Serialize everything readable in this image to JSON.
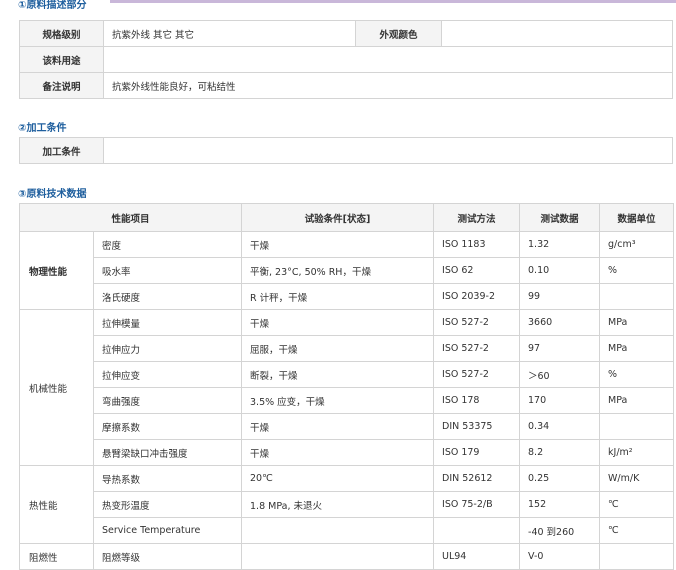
{
  "sections": {
    "s1": "①原料描述部分",
    "s2": "②加工条件",
    "s3": "③原料技术数据"
  },
  "desc": {
    "grade_label": "规格级别",
    "grade_value": "抗紫外线 其它 其它",
    "color_label": "外观颜色",
    "color_value": "",
    "use_label": "该料用途",
    "use_value": "",
    "note_label": "备注说明",
    "note_value": "抗紫外线性能良好，可粘结性"
  },
  "proc": {
    "label": "加工条件",
    "value": ""
  },
  "tech": {
    "headers": [
      "性能项目",
      "试验条件[状态]",
      "测试方法",
      "测试数据",
      "数据单位"
    ],
    "groups": [
      {
        "category": "物理性能",
        "bold": true,
        "rows": [
          [
            "密度",
            "干燥",
            "ISO 1183",
            "1.32",
            "g/cm³"
          ],
          [
            "吸水率",
            "平衡, 23°C, 50% RH，干燥",
            "ISO 62",
            "0.10",
            "%"
          ],
          [
            "洛氏硬度",
            "R 计秤，干燥",
            "ISO 2039-2",
            "99",
            ""
          ]
        ]
      },
      {
        "category": "机械性能",
        "bold": false,
        "rows": [
          [
            "拉伸模量",
            "干燥",
            "ISO 527-2",
            "3660",
            "MPa"
          ],
          [
            "拉伸应力",
            "屈服，干燥",
            "ISO 527-2",
            "97",
            "MPa"
          ],
          [
            "拉伸应变",
            "断裂，干燥",
            "ISO 527-2",
            "＞60",
            "%"
          ],
          [
            "弯曲强度",
            "3.5% 应变，干燥",
            "ISO 178",
            "170",
            "MPa"
          ],
          [
            "摩擦系数",
            "干燥",
            "DIN 53375",
            "0.34",
            ""
          ],
          [
            "悬臂梁缺口冲击强度",
            "干燥",
            "ISO 179",
            "8.2",
            "kJ/m²"
          ]
        ]
      },
      {
        "category": "热性能",
        "bold": false,
        "rows": [
          [
            "导热系数",
            "20℃",
            "DIN 52612",
            "0.25",
            "W/m/K"
          ],
          [
            "热变形温度",
            "1.8 MPa, 未退火",
            "ISO 75-2/B",
            "152",
            "℃"
          ],
          [
            "Service Temperature",
            "",
            "",
            "-40 到260",
            "℃"
          ]
        ]
      },
      {
        "category": "阻燃性",
        "bold": false,
        "rows": [
          [
            "阻燃等级",
            "",
            "UL94",
            "V-0",
            ""
          ]
        ]
      }
    ]
  }
}
